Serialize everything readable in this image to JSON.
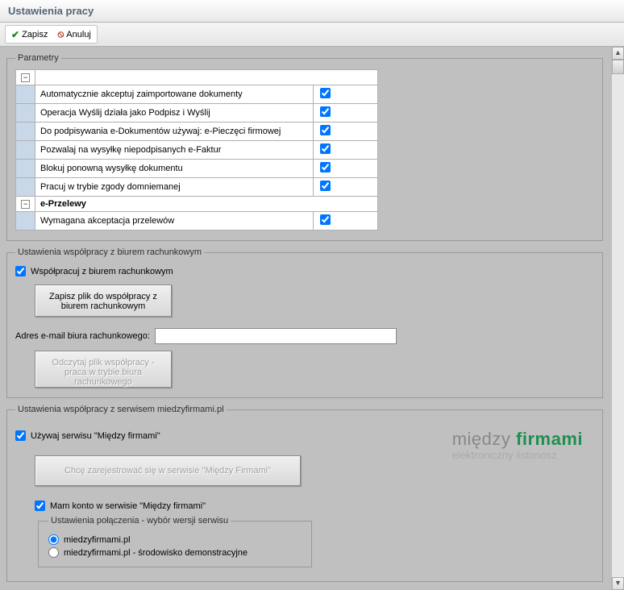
{
  "window": {
    "title": "Ustawienia pracy"
  },
  "toolbar": {
    "save": "Zapisz",
    "cancel": "Anuluj"
  },
  "params": {
    "legend": "Parametry",
    "items": [
      {
        "label": "Automatycznie akceptuj zaimportowane dokumenty",
        "checked": true
      },
      {
        "label": "Operacja Wyślij działa jako Podpisz i Wyślij",
        "checked": true
      },
      {
        "label": "Do podpisywania e-Dokumentów używaj: e-Pieczęci firmowej",
        "checked": true
      },
      {
        "label": "Pozwalaj na wysyłkę niepodpisanych e-Faktur",
        "checked": true
      },
      {
        "label": "Blokuj ponowną wysyłkę dokumentu",
        "checked": true
      },
      {
        "label": "Pracuj w trybie zgody domniemanej",
        "checked": true
      }
    ],
    "section2": {
      "title": "e-Przelewy"
    },
    "items2": [
      {
        "label": "Wymagana akceptacja przelewów",
        "checked": true
      }
    ]
  },
  "accounting": {
    "legend": "Ustawienia współpracy z biurem rachunkowym",
    "cooperate": {
      "label": "Współpracuj z biurem rachunkowym",
      "checked": true
    },
    "save_file_btn": "Zapisz plik do współpracy z biurem rachunkowym",
    "email_label": "Adres e-mail biura rachunkowego:",
    "email_value": "",
    "read_file_btn": "Odczytaj plik współpracy - praca w trybie biura rachunkowego"
  },
  "mf": {
    "legend": "Ustawienia współpracy z serwisem miedzyfirmami.pl",
    "use_service": {
      "label": "Używaj serwisu \"Między firmami\"",
      "checked": true
    },
    "register_btn": "Chcę zarejestrować się w serwisie \"Między Firmami\"",
    "have_account": {
      "label": "Mam konto w serwisie \"Między firmami\"",
      "checked": true
    },
    "conn": {
      "legend": "Ustawienia połączenia - wybór wersji serwisu",
      "opt1": "miedzyfirmami.pl",
      "opt2": "miedzyfirmami.pl - środowisko demonstracyjne",
      "selected": "opt1"
    },
    "logo": {
      "word1": "między",
      "word2": "firmami",
      "sub": "elektroniczny listonosz"
    }
  }
}
